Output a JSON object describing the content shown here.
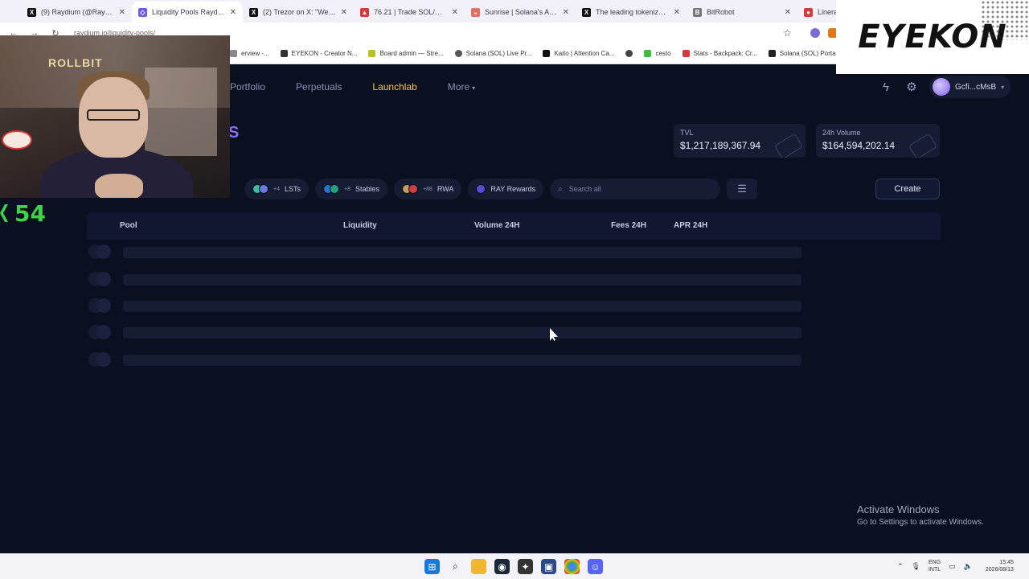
{
  "browser": {
    "tabs": [
      {
        "title": "(9) Raydium (@Raydium)",
        "favicon": "x-logo",
        "color": "#111111"
      },
      {
        "title": "Liquidity Pools Raydium",
        "favicon": "raydium-logo",
        "color": "#6c5ce7",
        "active": true
      },
      {
        "title": "(2) Trezor on X: \"We have",
        "favicon": "x-logo",
        "color": "#111111"
      },
      {
        "title": "76.21 | Trade SOL/USD",
        "favicon": "alert-logo",
        "color": "#d33a3a"
      },
      {
        "title": "Sunrise | Solana's Asset G",
        "favicon": "sunrise-logo",
        "color": "#e07060"
      },
      {
        "title": "The leading tokenization",
        "favicon": "x-logo",
        "color": "#111111"
      },
      {
        "title": "BitRobot",
        "favicon": "bitrobot-logo",
        "color": "#777777"
      },
      {
        "title": "Linera",
        "favicon": "linera-logo",
        "color": "#d33a3a"
      }
    ],
    "url": "raydium.io/liquidity-pools/",
    "bookmarks": [
      {
        "label": "erview -...",
        "color": "#888888"
      },
      {
        "label": "EYEKON - Creator N...",
        "color": "#333333"
      },
      {
        "label": "Board admin — Stre...",
        "color": "#b8c020"
      },
      {
        "label": "Solana (SOL) Live Pr...",
        "color": "#555555"
      },
      {
        "label": "Kaito | Attention Ca...",
        "color": "#111111"
      },
      {
        "label": "",
        "color": "#444444"
      },
      {
        "label": "cesto",
        "color": "#3bbf3b"
      },
      {
        "label": "Stats - Backpack: Cr...",
        "color": "#d33a3a"
      },
      {
        "label": "Solana (SOL) Portal...",
        "color": "#222222"
      }
    ]
  },
  "overlay": {
    "brand": "EYEKON",
    "counter": "54",
    "webcam_sign": "ROLLBIT"
  },
  "nav": {
    "items": [
      "Portfolio",
      "Perpetuals",
      "Launchlab",
      "More"
    ],
    "wallet": "Gcfi...cMsB"
  },
  "heading_fragment": "S",
  "stats": {
    "tvl_label": "TVL",
    "tvl_value": "$1,217,189,367.94",
    "volume_label": "24h Volume",
    "volume_value": "$164,594,202.14"
  },
  "filters": {
    "lsts_label": "LSTs",
    "lsts_more": "+4",
    "stables_label": "Stables",
    "stables_more": "+8",
    "rwa_label": "RWA",
    "rwa_more": "+88",
    "ray_label": "RAY Rewards",
    "search_placeholder": "Search all"
  },
  "create_label": "Create",
  "table": {
    "columns": [
      "Pool",
      "Liquidity",
      "Volume 24H",
      "Fees 24H",
      "APR 24H"
    ],
    "skeleton_rows": 5
  },
  "windows": {
    "activate_title": "Activate Windows",
    "activate_sub": "Go to Settings to activate Windows."
  },
  "taskbar": {
    "lang1": "ENG",
    "lang2": "INTL",
    "time": "15:45",
    "date": "2026/08/13"
  },
  "colors": {
    "accent_launchlab": "#ffc23d",
    "counter_green": "#3fd24a",
    "heading_purple": "#8a6cff"
  }
}
